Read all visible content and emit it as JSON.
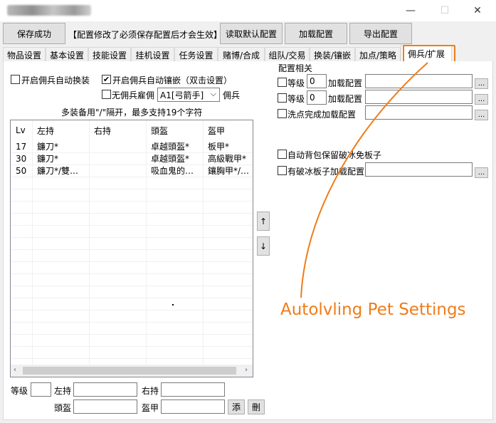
{
  "window": {
    "minimize": "—",
    "maximize": "☐",
    "close": "✕"
  },
  "toolbar": {
    "save_label": "保存成功",
    "notice": "【配置修改了必须保存配置后才会生效】",
    "read_default_label": "读取默认配置",
    "load_label": "加载配置",
    "export_label": "导出配置"
  },
  "tabs": [
    {
      "label": "物品设置"
    },
    {
      "label": "基本设置"
    },
    {
      "label": "技能设置"
    },
    {
      "label": "挂机设置"
    },
    {
      "label": "任务设置"
    },
    {
      "label": "赌博/合成"
    },
    {
      "label": "组队/交易"
    },
    {
      "label": "换装/镶嵌"
    },
    {
      "label": "加点/策略"
    },
    {
      "label": "佣兵/扩展"
    }
  ],
  "mercenary": {
    "auto_swap_label": "开启佣兵自动换装",
    "auto_swap_checked": false,
    "auto_inlay_label": "开启佣兵自动镶嵌（双击设置）",
    "auto_inlay_checked": true,
    "no_hire_label": "无佣兵雇佣",
    "no_hire_checked": false,
    "merc_type_value": "A1[弓箭手]",
    "merc_suffix": "佣兵",
    "hint": "多装备用\"/\"隔开，最多支持19个字符",
    "table": {
      "columns": [
        "Lv",
        "左持",
        "右持",
        "頭盔",
        "盔甲"
      ],
      "rows": [
        [
          "17",
          "鐮刀*",
          "",
          "卓越頭盔*",
          "板甲*"
        ],
        [
          "30",
          "鐮刀*",
          "",
          "卓越頭盔*",
          "高級戰甲*"
        ],
        [
          "50",
          "鐮刀*/雙…",
          "",
          "吸血鬼的…",
          "鑲胸甲*/…"
        ]
      ]
    },
    "up_arrow": "↑",
    "down_arrow": "↓",
    "form": {
      "level_label": "等级",
      "left_label": "左持",
      "right_label": "右持",
      "helmet_label": "頭盔",
      "armor_label": "盔甲",
      "add_label": "添",
      "delete_label": "刪"
    }
  },
  "config": {
    "group_title": "配置相关",
    "level1_label": "等级",
    "level1_value": "0",
    "level1_checked": false,
    "load1_label": "加载配置",
    "level2_label": "等级",
    "level2_value": "0",
    "level2_checked": false,
    "load2_label": "加载配置",
    "wash_label": "洗点完成加载配置",
    "wash_checked": false,
    "keep_ice_label": "自动背包保留破冰免板子",
    "keep_ice_checked": false,
    "ice_load_label": "有破冰板子加载配置",
    "ice_load_checked": false,
    "browse": "..."
  },
  "annotation": {
    "text": "Autolvling Pet Settings",
    "color": "#f07c19"
  }
}
